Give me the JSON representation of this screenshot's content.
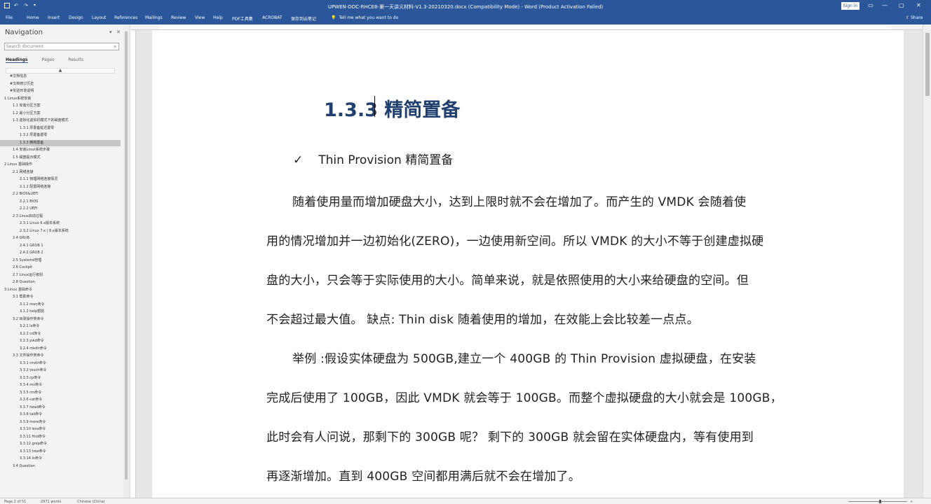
{
  "window": {
    "title": "UPWEN-DOC-RHCE8-第一天讲义材料-V1.3-20210320.docx (Compatibility Mode) - Word (Product Activation Failed)",
    "signin_label": "Sign in",
    "minimize": "—",
    "maximize": "▢",
    "close": "✕"
  },
  "ribbon": {
    "tabs": [
      "File",
      "Home",
      "Insert",
      "Design",
      "Layout",
      "References",
      "Mailings",
      "Review",
      "View",
      "Help",
      "PDF工具集",
      "ACROBAT",
      "保存到云笔记"
    ],
    "tell_me": "Tell me what you want to do",
    "share_label": "Share"
  },
  "nav": {
    "title": "Navigation",
    "search_placeholder": "Search document",
    "tabs": [
      "Headings",
      "Pages",
      "Results"
    ],
    "items": [
      {
        "label": "#文档信息",
        "indent": 0
      },
      {
        "label": "#文档修订历史",
        "indent": 0
      },
      {
        "label": "#实验环境说明",
        "indent": 0
      },
      {
        "label": "1 Linux系统安装",
        "indent": 1
      },
      {
        "label": "1.1 安装分区方案",
        "indent": 2
      },
      {
        "label": "1.2 最小分区方案",
        "indent": 2
      },
      {
        "label": "1.3 虚拟化虚拟机模式下的磁盘模式",
        "indent": 2
      },
      {
        "label": "1.3.1 厚置备延迟置零",
        "indent": 3
      },
      {
        "label": "1.3.2 厚置备置零",
        "indent": 3
      },
      {
        "label": "1.3.3 精简置备",
        "indent": 3,
        "selected": true
      },
      {
        "label": "1.4 安装Linux系统步骤",
        "indent": 2
      },
      {
        "label": "1.5 磁盘提示模式",
        "indent": 2
      },
      {
        "label": "2 Linux 基础操作",
        "indent": 1
      },
      {
        "label": "2.1 网络连接",
        "indent": 2
      },
      {
        "label": "2.1.1 物理网络连接情况",
        "indent": 3
      },
      {
        "label": "2.1.2 配置网络连接",
        "indent": 3
      },
      {
        "label": "2.2 BIOS&UEFI",
        "indent": 2
      },
      {
        "label": "2.2.1 BIOS",
        "indent": 3
      },
      {
        "label": "2.2.2 UEFI",
        "indent": 3
      },
      {
        "label": "2.3 Linux启动过程",
        "indent": 2
      },
      {
        "label": "2.3.1 Linux 6.x版本系统",
        "indent": 3
      },
      {
        "label": "2.3.2 Linux 7.x | 8.x版本系统",
        "indent": 3
      },
      {
        "label": "2.4 GRUB",
        "indent": 2
      },
      {
        "label": "2.4.1 GRUB 1",
        "indent": 3
      },
      {
        "label": "2.4.2 GRUB 2",
        "indent": 3
      },
      {
        "label": "2.5 Systemd管理",
        "indent": 2
      },
      {
        "label": "2.6 Cockpit",
        "indent": 2
      },
      {
        "label": "2.7 Linux运行级别",
        "indent": 2
      },
      {
        "label": "2.8 Question",
        "indent": 2
      },
      {
        "label": "3 Linux 基础命令",
        "indent": 1
      },
      {
        "label": "3.1 帮助命令",
        "indent": 2
      },
      {
        "label": "3.1.1 man命令",
        "indent": 3
      },
      {
        "label": "3.1.2 help帮助",
        "indent": 3
      },
      {
        "label": "3.2 目录操作类命令",
        "indent": 2
      },
      {
        "label": "3.2.1 ls命令",
        "indent": 3
      },
      {
        "label": "3.2.2 cd命令",
        "indent": 3
      },
      {
        "label": "3.2.3 pwd命令",
        "indent": 3
      },
      {
        "label": "3.2.4 mkdir命令",
        "indent": 3
      },
      {
        "label": "3.3 文件操作类命令",
        "indent": 2
      },
      {
        "label": "3.3.1 rmdir命令",
        "indent": 3
      },
      {
        "label": "3.3.2 touch命令",
        "indent": 3
      },
      {
        "label": "3.3.3 cp命令",
        "indent": 3
      },
      {
        "label": "3.3.4 mv命令",
        "indent": 3
      },
      {
        "label": "3.3.5 rm命令",
        "indent": 3
      },
      {
        "label": "3.3.6 cat命令",
        "indent": 3
      },
      {
        "label": "3.3.7 head命令",
        "indent": 3
      },
      {
        "label": "3.3.8 tail命令",
        "indent": 3
      },
      {
        "label": "3.3.9 more命令",
        "indent": 3
      },
      {
        "label": "3.3.10 less命令",
        "indent": 3
      },
      {
        "label": "3.3.11 find命令",
        "indent": 3
      },
      {
        "label": "3.3.12 grep命令",
        "indent": 3
      },
      {
        "label": "3.3.13 tree命令",
        "indent": 3
      },
      {
        "label": "3.3.14 ln命令",
        "indent": 3
      },
      {
        "label": "3.4 Question",
        "indent": 2
      }
    ]
  },
  "document": {
    "heading": "1.3.3 精简置备",
    "bullet_check": "✓",
    "bullet_text": "Thin Provision 精简置备",
    "paragraph1": [
      "随着使用量而增加硬盘大小，达到上限时就不会在增加了。而产生的 VMDK 会随着使",
      "用的情况增加并一边初始化(ZERO)，一边使用新空间。所以 VMDK 的大小不等于创建虚拟硬",
      "盘的大小，只会等于实际使用的大小。简单来说，就是依照使用的大小来给硬盘的空间。但",
      "不会超过最大值。 缺点: Thin disk 随着使用的增加，在效能上会比较差一点点。"
    ],
    "paragraph2": [
      "举例 :假设实体硬盘为 500GB,建立一个 400GB 的 Thin Provision 虚拟硬盘，在安装",
      "完成后使用了 100GB，因此 VMDK 就会等于 100GB。而整个虚拟硬盘的大小就会是 100GB，",
      "此时会有人问说，那剩下的 300GB 呢？ 剩下的 300GB 就会留在实体硬盘内，等有使用到",
      "再逐渐增加。直到 400GB 空间都用满后就不会在增加了。"
    ]
  },
  "status": {
    "page": "Page 2 of 51",
    "words": "2971 words",
    "language": "Chinese (China)",
    "zoom": "+"
  }
}
